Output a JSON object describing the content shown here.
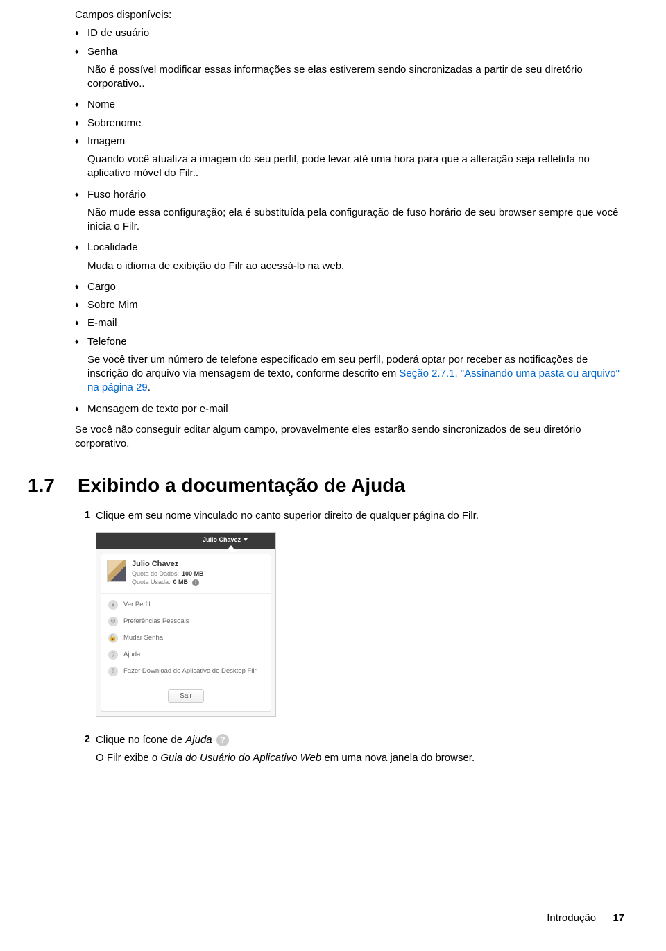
{
  "fields": {
    "intro": "Campos disponíveis:",
    "id_usuario": "ID de usuário",
    "senha": "Senha",
    "senha_note": "Não é possível modificar essas informações se elas estiverem sendo sincronizadas a partir de seu diretório corporativo..",
    "nome": "Nome",
    "sobrenome": "Sobrenome",
    "imagem": "Imagem",
    "imagem_note": "Quando você atualiza a imagem do seu perfil, pode levar até uma hora para que a alteração seja refletida no aplicativo móvel do Filr..",
    "fuso": "Fuso horário",
    "fuso_note": "Não mude essa configuração; ela é substituída pela configuração de fuso horário de seu browser sempre que você inicia o Filr.",
    "localidade": "Localidade",
    "localidade_note": "Muda o idioma de exibição do Filr ao acessá-lo na web.",
    "cargo": "Cargo",
    "sobre_mim": "Sobre Mim",
    "email": "E-mail",
    "telefone": "Telefone",
    "telefone_note_a": "Se você tiver um número de telefone especificado em seu perfil, poderá optar por receber as notificações de inscrição do arquivo via mensagem de texto, conforme descrito em ",
    "telefone_link": "Seção 2.7.1, \"Assinando uma pasta ou arquivo\" na página 29",
    "telefone_note_b": ".",
    "msg_texto": "Mensagem de texto por e-mail",
    "sync_note": "Se você não conseguir editar algum campo, provavelmente eles estarão sendo sincronizados de seu diretório corporativo."
  },
  "section": {
    "num": "1.7",
    "title": "Exibindo a documentação de Ajuda"
  },
  "steps": {
    "n1": "1",
    "s1": "Clique em seu nome vinculado no canto superior direito de qualquer página do Filr.",
    "n2": "2",
    "s2a": "Clique no ícone de ",
    "s2b": "Ajuda",
    "s2c": " ",
    "s2_out_a": "O Filr exibe o ",
    "s2_out_b": "Guia do Usuário do Aplicativo Web",
    "s2_out_c": " em uma nova janela do browser."
  },
  "menu": {
    "topname": "Julio Chavez",
    "username": "Julio Chavez",
    "quota_label": "Quota de Dados:",
    "quota_value": "100 MB",
    "used_label": "Quota Usada:",
    "used_value": "0 MB",
    "mi1": "Ver Perfil",
    "mi2": "Preferências Pessoais",
    "mi3": "Mudar Senha",
    "mi4": "Ajuda",
    "mi5": "Fazer Download do Aplicativo de Desktop Filr",
    "exit": "Sair"
  },
  "footer": {
    "label": "Introdução",
    "page": "17"
  }
}
